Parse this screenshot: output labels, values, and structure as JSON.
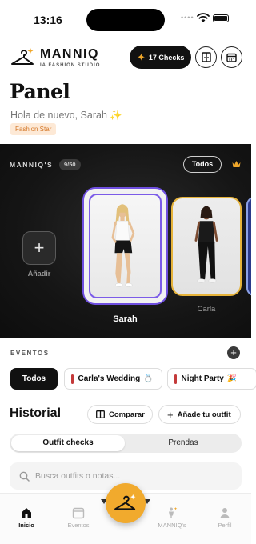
{
  "status_bar": {
    "time": "13:16"
  },
  "header": {
    "brand_name": "MANNIQ",
    "brand_tagline": "IA FASHION STUDIO",
    "checks_label": "17 Checks",
    "icons": [
      "wardrobe-icon",
      "calendar-icon"
    ]
  },
  "panel": {
    "title": "Panel",
    "greeting": "Hola de nuevo, Sarah",
    "greeting_emoji": "✨",
    "badge": "Fashion Star"
  },
  "manniqs": {
    "label": "MANNIQ'S",
    "count": "9/50",
    "filter": "Todos",
    "add_label": "Añadir",
    "cards": [
      {
        "name": "Sarah",
        "selected": true
      },
      {
        "name": "Carla",
        "selected": false
      }
    ]
  },
  "eventos": {
    "label": "EVENTOS",
    "chips": [
      {
        "label": "Todos",
        "emoji": ""
      },
      {
        "label": "Carla's Wedding",
        "emoji": "💍"
      },
      {
        "label": "Night Party",
        "emoji": "🎉"
      }
    ]
  },
  "historial": {
    "title": "Historial",
    "compare_label": "Comparar",
    "add_outfit_label": "Añade tu outfit",
    "tabs": [
      "Outfit checks",
      "Prendas"
    ],
    "search_placeholder": "Busca outfits o notas..."
  },
  "tabbar": {
    "items": [
      "Inicio",
      "Eventos",
      "MANNIQ's",
      "Perfil"
    ]
  },
  "colors": {
    "accent": "#f1aa2d",
    "selected_border": "#7b5be8",
    "dark_bg": "#151515"
  }
}
